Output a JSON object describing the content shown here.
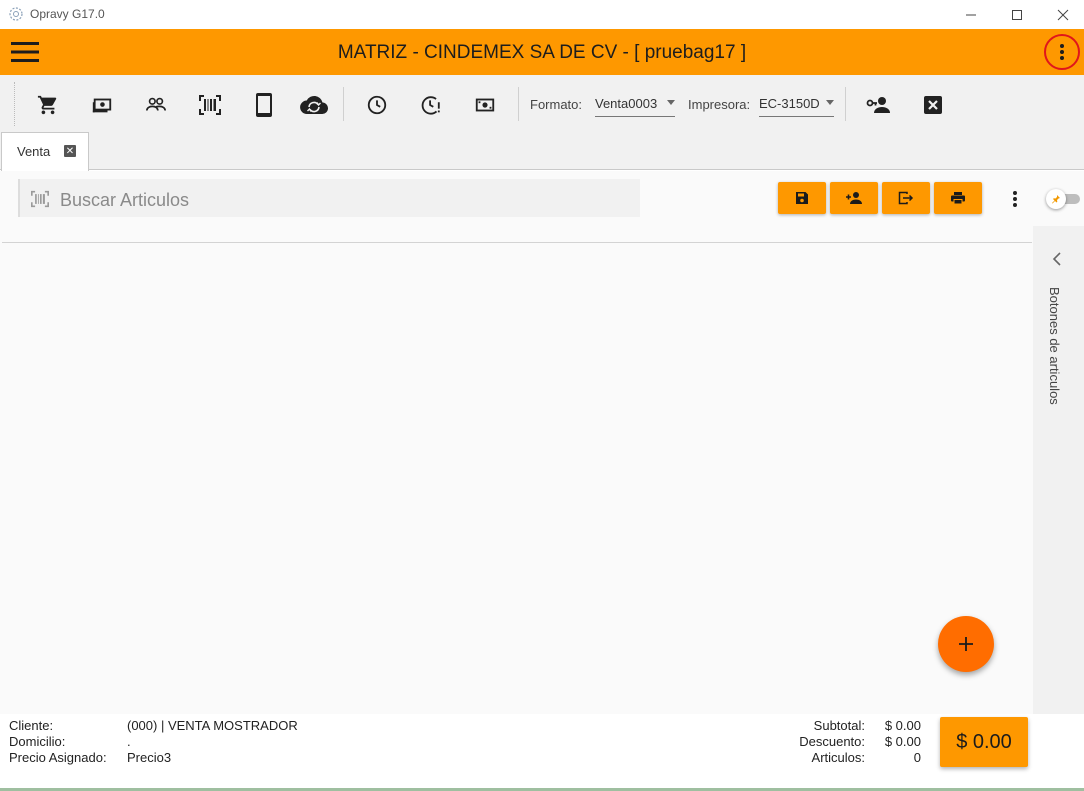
{
  "window": {
    "title": "Opravy G17.0",
    "controls": [
      "minimize",
      "maximize",
      "close"
    ]
  },
  "header": {
    "title": "MATRIZ - CINDEMEX SA DE CV - [ pruebag17 ]",
    "accent_color": "#fe9800",
    "highlight_color": "#e0161b"
  },
  "toolbar": {
    "icons": [
      "cart-icon",
      "cash-icon",
      "users-icon",
      "barcode-icon",
      "tablet-icon",
      "cloud-sync-icon",
      "clock-icon",
      "clock-alert-icon",
      "money-icon"
    ],
    "formato_label": "Formato:",
    "formato_value": "Venta0003",
    "impresora_label": "Impresora:",
    "impresora_value": "EC-3150D",
    "extra_icons": [
      "user-key-icon",
      "close-box-icon"
    ]
  },
  "tabs": [
    {
      "label": "Venta",
      "active": true
    }
  ],
  "search": {
    "placeholder": "Buscar Articulos"
  },
  "actions": [
    "save-icon",
    "add-user-icon",
    "exit-icon",
    "print-icon"
  ],
  "side_panel": {
    "label": "Botones de articulos"
  },
  "footer": {
    "cliente_label": "Cliente:",
    "cliente_value": "(000) | VENTA MOSTRADOR",
    "domicilio_label": "Domicilio:",
    "domicilio_value": ".",
    "precio_label": "Precio Asignado:",
    "precio_value": "Precio3",
    "subtotal_label": "Subtotal:",
    "subtotal_value": "$ 0.00",
    "descuento_label": "Descuento:",
    "descuento_value": "$ 0.00",
    "articulos_label": "Articulos:",
    "articulos_value": "0",
    "total": "$ 0.00"
  },
  "fab_color": "#ff6d00"
}
